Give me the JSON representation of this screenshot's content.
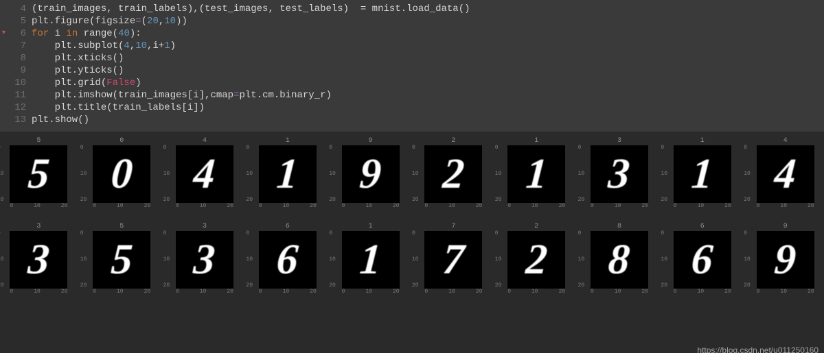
{
  "code": {
    "lines": [
      {
        "n": "4",
        "mark": "",
        "tokens": [
          {
            "t": "(train_images, train_labels),(test_images, test_labels)  = mnist.load_data()",
            "c": "src"
          }
        ]
      },
      {
        "n": "5",
        "mark": "",
        "tokens": [
          {
            "t": "plt.figure(figsize",
            "c": "src"
          },
          {
            "t": "=",
            "c": "assign"
          },
          {
            "t": "(",
            "c": "paren"
          },
          {
            "t": "20",
            "c": "num"
          },
          {
            "t": ",",
            "c": "src"
          },
          {
            "t": "10",
            "c": "num"
          },
          {
            "t": "))",
            "c": "paren"
          }
        ]
      },
      {
        "n": "6",
        "mark": "▾",
        "tokens": [
          {
            "t": "for ",
            "c": "kw"
          },
          {
            "t": "i ",
            "c": "src"
          },
          {
            "t": "in ",
            "c": "kw"
          },
          {
            "t": "range",
            "c": "src"
          },
          {
            "t": "(",
            "c": "paren"
          },
          {
            "t": "40",
            "c": "num"
          },
          {
            "t": "):",
            "c": "paren"
          }
        ]
      },
      {
        "n": "7",
        "mark": "",
        "tokens": [
          {
            "t": "    plt.subplot(",
            "c": "src"
          },
          {
            "t": "4",
            "c": "num"
          },
          {
            "t": ",",
            "c": "src"
          },
          {
            "t": "10",
            "c": "num"
          },
          {
            "t": ",i",
            "c": "src"
          },
          {
            "t": "+",
            "c": "op"
          },
          {
            "t": "1",
            "c": "num"
          },
          {
            "t": ")",
            "c": "paren"
          }
        ]
      },
      {
        "n": "8",
        "mark": "",
        "tokens": [
          {
            "t": "    plt.xticks()",
            "c": "src"
          }
        ]
      },
      {
        "n": "9",
        "mark": "",
        "tokens": [
          {
            "t": "    plt.yticks()",
            "c": "src"
          }
        ]
      },
      {
        "n": "10",
        "mark": "",
        "tokens": [
          {
            "t": "    plt.grid(",
            "c": "src"
          },
          {
            "t": "False",
            "c": "bool"
          },
          {
            "t": ")",
            "c": "paren"
          }
        ]
      },
      {
        "n": "11",
        "mark": "",
        "tokens": [
          {
            "t": "    plt.imshow(train_images[i],cmap",
            "c": "src"
          },
          {
            "t": "=",
            "c": "assign"
          },
          {
            "t": "plt.cm.binary_r)",
            "c": "src"
          }
        ]
      },
      {
        "n": "12",
        "mark": "",
        "tokens": [
          {
            "t": "    plt.title(train_labels[i])",
            "c": "src"
          }
        ]
      },
      {
        "n": "13",
        "mark": "",
        "tokens": [
          {
            "t": "plt.show()",
            "c": "src"
          }
        ]
      }
    ]
  },
  "figure": {
    "axis_x_ticks": [
      "0",
      "10",
      "20"
    ],
    "axis_y_ticks": [
      "0",
      "10",
      "20"
    ],
    "rows": [
      [
        {
          "label": "5",
          "glyph": "5"
        },
        {
          "label": "0",
          "glyph": "0"
        },
        {
          "label": "4",
          "glyph": "4"
        },
        {
          "label": "1",
          "glyph": "1"
        },
        {
          "label": "9",
          "glyph": "9"
        },
        {
          "label": "2",
          "glyph": "2"
        },
        {
          "label": "1",
          "glyph": "1"
        },
        {
          "label": "3",
          "glyph": "3"
        },
        {
          "label": "1",
          "glyph": "1"
        },
        {
          "label": "4",
          "glyph": "4"
        }
      ],
      [
        {
          "label": "3",
          "glyph": "3"
        },
        {
          "label": "5",
          "glyph": "5"
        },
        {
          "label": "3",
          "glyph": "3"
        },
        {
          "label": "6",
          "glyph": "6"
        },
        {
          "label": "1",
          "glyph": "1"
        },
        {
          "label": "7",
          "glyph": "7"
        },
        {
          "label": "2",
          "glyph": "2"
        },
        {
          "label": "8",
          "glyph": "8"
        },
        {
          "label": "6",
          "glyph": "6"
        },
        {
          "label": "9",
          "glyph": "9"
        }
      ]
    ]
  },
  "watermark": "https://blog.csdn.net/u011250160"
}
